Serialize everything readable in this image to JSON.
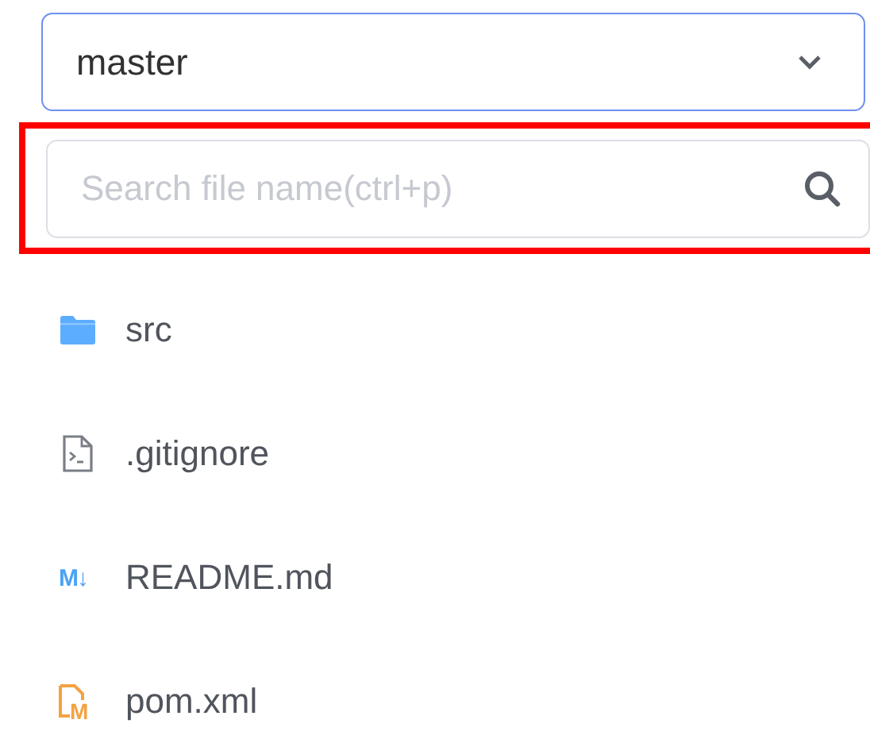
{
  "branch_select": {
    "value": "master"
  },
  "search": {
    "placeholder": "Search file name(ctrl+p)",
    "highlighted": true
  },
  "files": [
    {
      "kind": "folder",
      "name": "src"
    },
    {
      "kind": "shell",
      "name": ".gitignore"
    },
    {
      "kind": "markdown",
      "name": "README.md",
      "badge": "M↓"
    },
    {
      "kind": "maven",
      "name": "pom.xml",
      "badge": "M"
    }
  ]
}
